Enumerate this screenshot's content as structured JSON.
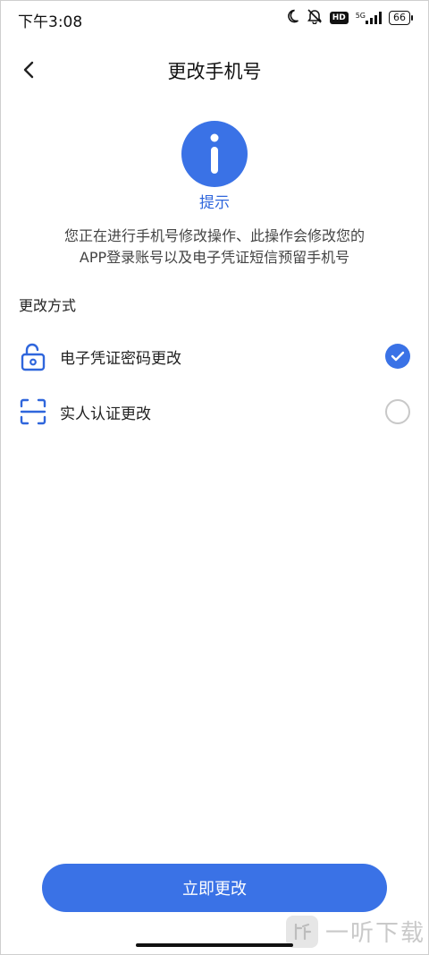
{
  "status_bar": {
    "time": "下午3:08",
    "network": "5G",
    "hd_badge": "HD",
    "battery": "66",
    "icons": [
      "moon-icon",
      "mute-icon",
      "hd-icon",
      "signal-icon",
      "battery-icon"
    ]
  },
  "header": {
    "title": "更改手机号",
    "back_icon": "chevron-left-icon"
  },
  "info": {
    "icon": "info-icon",
    "label": "提示",
    "line1": "您正在进行手机号修改操作、此操作会修改您的",
    "line2": "APP登录账号以及电子凭证短信预留手机号"
  },
  "methods": {
    "label": "更改方式",
    "options": [
      {
        "icon": "unlock-icon",
        "label": "电子凭证密码更改",
        "selected": true
      },
      {
        "icon": "face-scan-icon",
        "label": "实人认证更改",
        "selected": false
      }
    ]
  },
  "actions": {
    "submit_label": "立即更改"
  },
  "watermark": {
    "text": "一听下载"
  },
  "colors": {
    "accent": "#3a72e6",
    "tip_text": "#2f66dc"
  }
}
